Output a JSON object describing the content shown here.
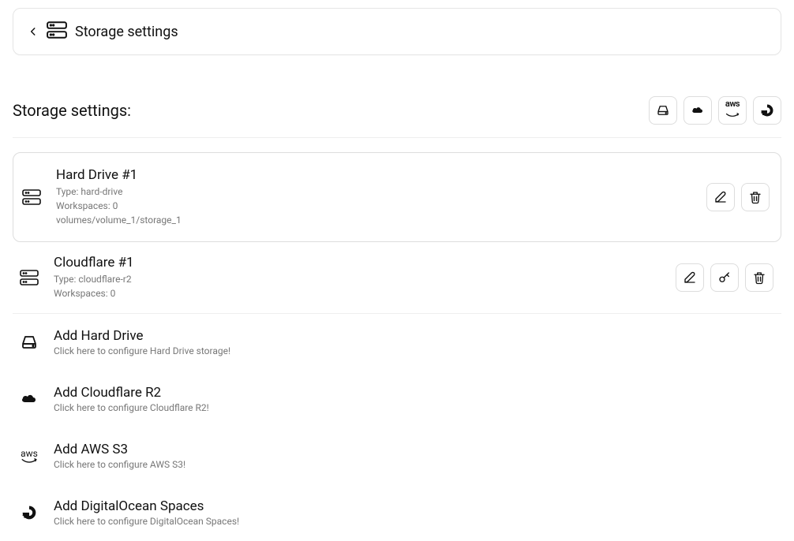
{
  "header": {
    "title": "Storage settings"
  },
  "section": {
    "title": "Storage settings:"
  },
  "storages": [
    {
      "name": "Hard Drive #1",
      "type_line": "Type: hard-drive",
      "workspaces_line": "Workspaces: 0",
      "path_line": "volumes/volume_1/storage_1"
    },
    {
      "name": "Cloudflare #1",
      "type_line": "Type: cloudflare-r2",
      "workspaces_line": "Workspaces: 0"
    }
  ],
  "add_options": [
    {
      "title": "Add Hard Drive",
      "desc": "Click here to configure Hard Drive storage!"
    },
    {
      "title": "Add Cloudflare R2",
      "desc": "Click here to configure Cloudflare R2!"
    },
    {
      "title": "Add AWS S3",
      "desc": "Click here to configure AWS S3!"
    },
    {
      "title": "Add DigitalOcean Spaces",
      "desc": "Click here to configure DigitalOcean Spaces!"
    }
  ]
}
